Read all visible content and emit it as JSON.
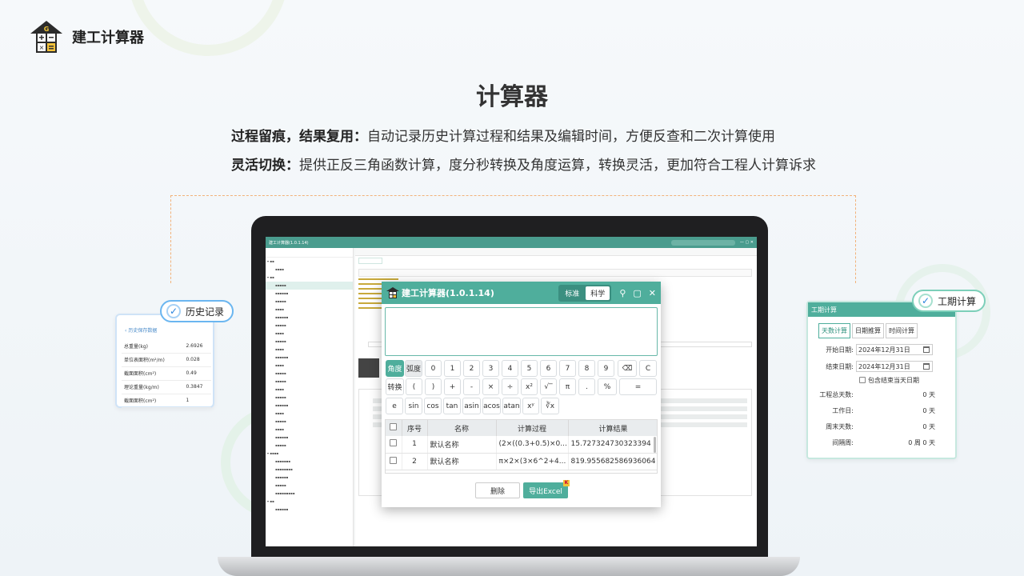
{
  "brand": {
    "name": "建工计算器"
  },
  "page": {
    "title": "计算器"
  },
  "descriptions": [
    {
      "bold": "过程留痕，结果复用：",
      "text": "自动记录历史计算过程和结果及编辑时间，方便反查和二次计算使用"
    },
    {
      "bold": "灵活切换：",
      "text": "提供正反三角函数计算，度分秒转换及角度运算，转换灵活，更加符合工程人计算诉求"
    }
  ],
  "history_card": {
    "tag": "历史记录",
    "back": "历史保存数据",
    "rows": [
      {
        "label": "总重量(kg)",
        "value": "2.6926"
      },
      {
        "label": "单位表面积(m²/m)",
        "value": "0.028"
      },
      {
        "label": "截面面积(cm²)",
        "value": "0.49"
      },
      {
        "label": "理论重量(kg/m)",
        "value": "0.3847"
      },
      {
        "label": "截面面积(cm²)",
        "value": "1"
      }
    ]
  },
  "calculator": {
    "title": "建工计算器(1.0.1.14)",
    "modes": [
      "标准",
      "科学"
    ],
    "active_mode": "科学",
    "keys_row1": [
      "角度",
      "弧度",
      "0",
      "1",
      "2",
      "3",
      "4",
      "5",
      "6",
      "7",
      "8",
      "9",
      "⌫",
      "C"
    ],
    "keys_row2": [
      "转换",
      "(",
      ")",
      "+",
      "-",
      "×",
      "÷",
      "x²",
      "√‾",
      "π",
      ".",
      "%",
      "="
    ],
    "keys_row3": [
      "e",
      "sin",
      "cos",
      "tan",
      "asin",
      "acos",
      "atan",
      "xʸ",
      "∛x"
    ],
    "history_headers": [
      "序号",
      "名称",
      "计算过程",
      "计算结果"
    ],
    "history_rows": [
      {
        "no": "1",
        "name": "默认名称",
        "process": "(2×((0.3+0.5)×0...",
        "result": "15.727324730323394"
      },
      {
        "no": "2",
        "name": "默认名称",
        "process": "π×2×(3×6^2+4...",
        "result": "819.955682586936064"
      }
    ],
    "delete_label": "删除",
    "export_label": "导出Excel"
  },
  "duration_card": {
    "tag": "工期计算",
    "header": "工期计算",
    "tabs": [
      "天数计算",
      "日期推算",
      "时间计算"
    ],
    "start_label": "开始日期:",
    "start_value": "2024年12月31日",
    "end_label": "结束日期:",
    "end_value": "2024年12月31日",
    "include_end": "包含结束当天日期",
    "results": [
      {
        "label": "工程总天数:",
        "value": "0 天"
      },
      {
        "label": "工作日:",
        "value": "0 天"
      },
      {
        "label": "周末天数:",
        "value": "0 天"
      },
      {
        "label": "间隔周:",
        "value": "0 周 0 天"
      }
    ]
  },
  "colors": {
    "accent": "#4fae9c",
    "tag_border": "#6bb6f0",
    "dashed": "#f2b27a"
  }
}
